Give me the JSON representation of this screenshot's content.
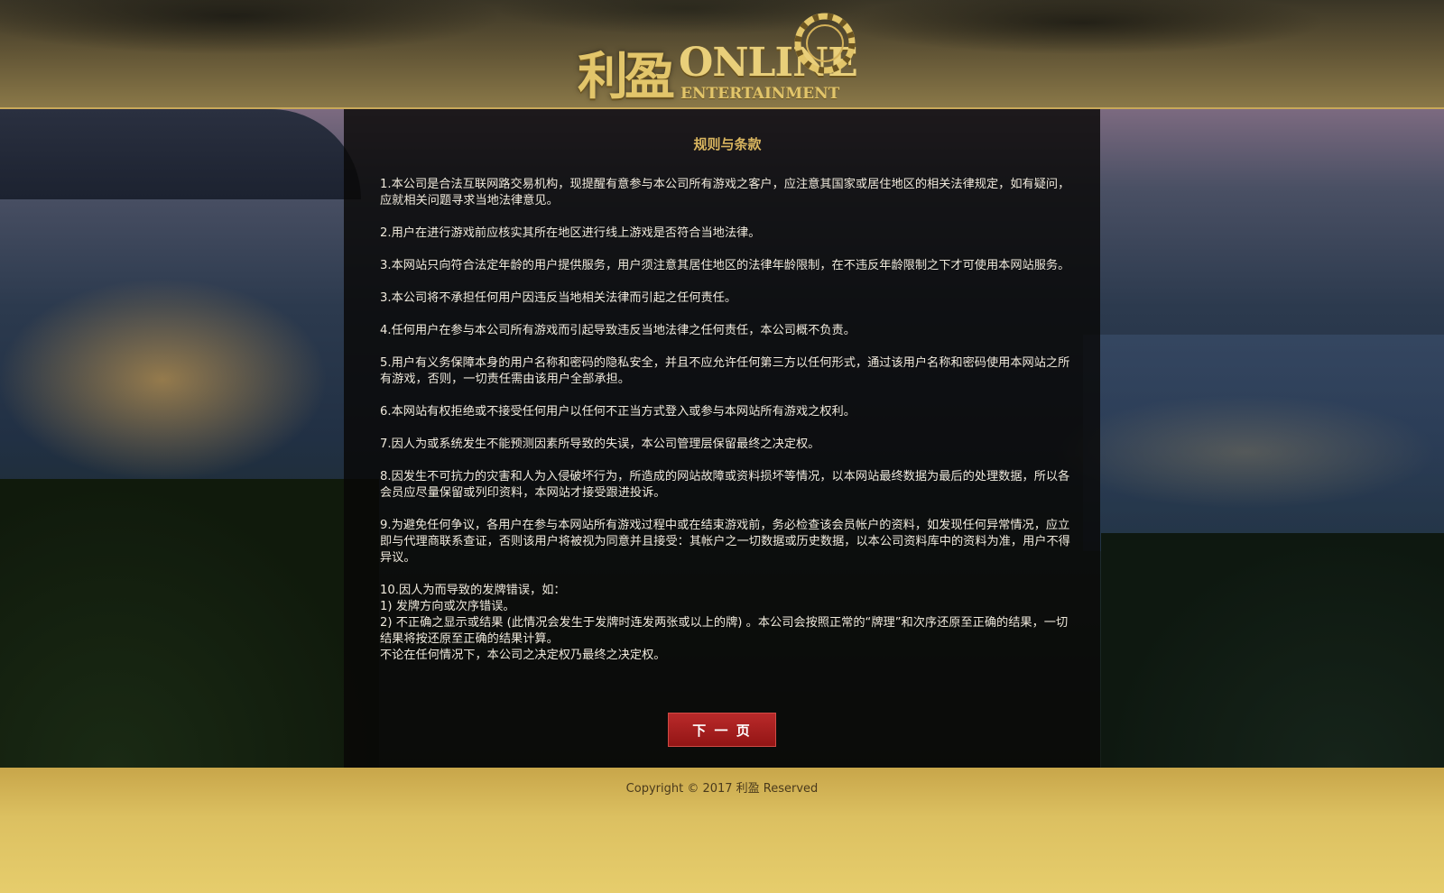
{
  "header": {
    "logo": {
      "cn": "利盈",
      "online": "ONLINE",
      "entertainment": "ENTERTAINMENT"
    }
  },
  "panel": {
    "title": "规则与条款",
    "terms": [
      "1.本公司是合法互联网路交易机构，现提醒有意参与本公司所有游戏之客户，应注意其国家或居住地区的相关法律规定，如有疑问，应就相关问题寻求当地法律意见。",
      "2.用户在进行游戏前应核实其所在地区进行线上游戏是否符合当地法律。",
      "3.本网站只向符合法定年龄的用户提供服务，用户须注意其居住地区的法律年龄限制，在不违反年龄限制之下才可使用本网站服务。",
      "3.本公司将不承担任何用户因违反当地相关法律而引起之任何责任。",
      "4.任何用户在参与本公司所有游戏而引起导致违反当地法律之任何责任，本公司概不负责。",
      "5.用户有义务保障本身的用户名称和密码的隐私安全，并且不应允许任何第三方以任何形式，通过该用户名称和密码使用本网站之所有游戏，否则，一切责任需由该用户全部承担。",
      "6.本网站有权拒绝或不接受任何用户以任何不正当方式登入或参与本网站所有游戏之权利。",
      "7.因人为或系统发生不能预测因素所导致的失误，本公司管理层保留最终之决定权。",
      "8.因发生不可抗力的灾害和人为入侵破坏行为，所造成的网站故障或资料损坏等情况，以本网站最终数据为最后的处理数据，所以各会员应尽量保留或列印资料，本网站才接受跟进投诉。",
      "9.为避免任何争议，各用户在参与本网站所有游戏过程中或在结束游戏前，务必检查该会员帐户的资料，如发现任何异常情况，应立即与代理商联系查证，否则该用户将被视为同意并且接受：其帐户之一切数据或历史数据，以本公司资料库中的资料为准，用户不得异议。"
    ],
    "term10": {
      "intro": "10.因人为而导致的发牌错误，如：",
      "item1": "1) 发牌方向或次序错误。",
      "item2": "2) 不正确之显示或结果 (此情况会发生于发牌时连发两张或以上的牌) 。本公司会按照正常的“牌理”和次序还原至正确的结果，一切结果将按还原至正确的结果计算。",
      "final": "不论在任何情况下，本公司之决定权乃最终之决定权。"
    },
    "next_button": "下 一 页"
  },
  "footer": {
    "copyright": "Copyright © 2017 利盈 Reserved"
  },
  "colors": {
    "gold": "#d9b55f",
    "button_red": "#a81f1f",
    "footer_gold": "#dcc061"
  }
}
